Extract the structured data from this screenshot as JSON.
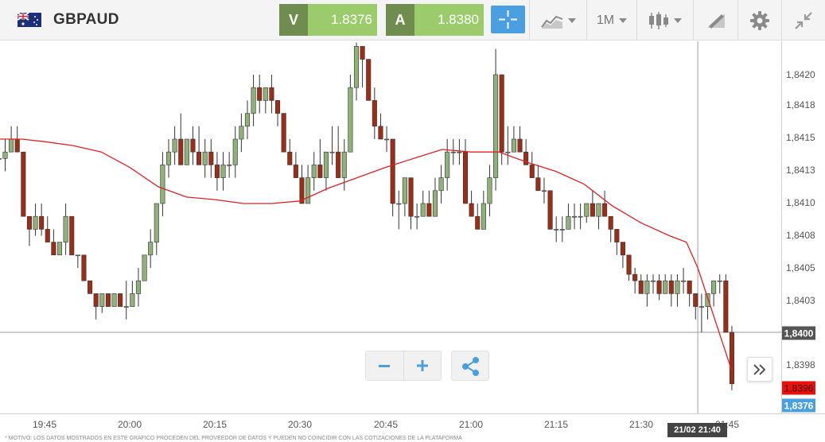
{
  "header": {
    "symbol": "GBPAUD",
    "sell": {
      "label": "V",
      "price": "1.8376"
    },
    "buy": {
      "label": "A",
      "price": "1.8380"
    },
    "crosshair_icon": "crosshair-icon",
    "indicators_icon": "indicators-icon",
    "timeframe": "1M",
    "chart_type_icon": "candlestick-icon",
    "draw_icon": "pencil-ruler-icon",
    "settings_icon": "gear-icon",
    "collapse_icon": "collapse-arrows-icon"
  },
  "chart": {
    "y_ticks": [
      "1,8420",
      "1,8418",
      "1,8415",
      "1,8413",
      "1,8410",
      "1,8408",
      "1,8405",
      "1,8403",
      "1,8398"
    ],
    "x_ticks": [
      "19:45",
      "20:00",
      "20:15",
      "20:30",
      "20:45",
      "21:00",
      "21:15",
      "21:30",
      "21:45"
    ],
    "last_price_tag": "1,8400",
    "ask_tag": "1,8396",
    "bid_tag": "1,8376",
    "crosshair_time": "21/02 21:40",
    "footer_text": "* MOTIVO: LOS DATOS MOSTRADOS EN ESTE GRÁFICO PROCEDEN DEL PROVEEDOR DE DATOS Y PUEDEN NO COINCIDIR CON LAS COTIZACIONES DE LA PLATAFORMA"
  },
  "colors": {
    "bull": "#8fb27a",
    "bear": "#9c2e17",
    "ma_line": "#e02020",
    "accent": "#4a9fe0"
  },
  "chart_data": {
    "type": "candlestick",
    "symbol": "GBPAUD",
    "interval": "1M",
    "x_range": [
      "19:37",
      "21:46"
    ],
    "ylim": [
      1.83955,
      1.84228
    ],
    "candles": [
      {
        "o": 1.84135,
        "h": 1.8415,
        "l": 1.84135,
        "c": 1.84135
      },
      {
        "o": 1.84135,
        "h": 1.8415,
        "l": 1.84125,
        "c": 1.8414
      },
      {
        "o": 1.8414,
        "h": 1.8416,
        "l": 1.8414,
        "c": 1.8415
      },
      {
        "o": 1.8415,
        "h": 1.8416,
        "l": 1.8414,
        "c": 1.8414
      },
      {
        "o": 1.8414,
        "h": 1.8414,
        "l": 1.8409,
        "c": 1.8409
      },
      {
        "o": 1.8409,
        "h": 1.8409,
        "l": 1.84067,
        "c": 1.8408
      },
      {
        "o": 1.8408,
        "h": 1.841,
        "l": 1.84075,
        "c": 1.8409
      },
      {
        "o": 1.8409,
        "h": 1.841,
        "l": 1.84075,
        "c": 1.8408
      },
      {
        "o": 1.8408,
        "h": 1.8409,
        "l": 1.8407,
        "c": 1.8407
      },
      {
        "o": 1.8407,
        "h": 1.8408,
        "l": 1.8406,
        "c": 1.8406
      },
      {
        "o": 1.8406,
        "h": 1.8406,
        "l": 1.8406,
        "c": 1.8407
      },
      {
        "o": 1.8407,
        "h": 1.841,
        "l": 1.8406,
        "c": 1.8409
      },
      {
        "o": 1.8409,
        "h": 1.8409,
        "l": 1.8406,
        "c": 1.8406
      },
      {
        "o": 1.8406,
        "h": 1.8406,
        "l": 1.8405,
        "c": 1.8406
      },
      {
        "o": 1.8406,
        "h": 1.8406,
        "l": 1.8404,
        "c": 1.8404
      },
      {
        "o": 1.8404,
        "h": 1.8404,
        "l": 1.8403,
        "c": 1.8403
      },
      {
        "o": 1.8403,
        "h": 1.8403,
        "l": 1.8401,
        "c": 1.8402
      },
      {
        "o": 1.8402,
        "h": 1.8403,
        "l": 1.84015,
        "c": 1.8403
      },
      {
        "o": 1.8403,
        "h": 1.8403,
        "l": 1.8402,
        "c": 1.8402
      },
      {
        "o": 1.8402,
        "h": 1.8403,
        "l": 1.8402,
        "c": 1.8403
      },
      {
        "o": 1.8403,
        "h": 1.8403,
        "l": 1.8402,
        "c": 1.8402
      },
      {
        "o": 1.8402,
        "h": 1.8404,
        "l": 1.8401,
        "c": 1.8402
      },
      {
        "o": 1.8402,
        "h": 1.8404,
        "l": 1.8402,
        "c": 1.8403
      },
      {
        "o": 1.8403,
        "h": 1.8405,
        "l": 1.8402,
        "c": 1.8404
      },
      {
        "o": 1.8404,
        "h": 1.8406,
        "l": 1.8404,
        "c": 1.8406
      },
      {
        "o": 1.8406,
        "h": 1.8408,
        "l": 1.8405,
        "c": 1.8407
      },
      {
        "o": 1.8407,
        "h": 1.841,
        "l": 1.8406,
        "c": 1.841
      },
      {
        "o": 1.841,
        "h": 1.8414,
        "l": 1.8409,
        "c": 1.8413
      },
      {
        "o": 1.8413,
        "h": 1.8415,
        "l": 1.8412,
        "c": 1.8414
      },
      {
        "o": 1.8414,
        "h": 1.8416,
        "l": 1.8413,
        "c": 1.8415
      },
      {
        "o": 1.8415,
        "h": 1.8417,
        "l": 1.8413,
        "c": 1.8413
      },
      {
        "o": 1.8413,
        "h": 1.8415,
        "l": 1.8413,
        "c": 1.8415
      },
      {
        "o": 1.8415,
        "h": 1.8416,
        "l": 1.8413,
        "c": 1.8414
      },
      {
        "o": 1.8414,
        "h": 1.8416,
        "l": 1.8413,
        "c": 1.8413
      },
      {
        "o": 1.8413,
        "h": 1.8415,
        "l": 1.8412,
        "c": 1.8414
      },
      {
        "o": 1.8414,
        "h": 1.8415,
        "l": 1.8412,
        "c": 1.8413
      },
      {
        "o": 1.8413,
        "h": 1.8414,
        "l": 1.8411,
        "c": 1.8412
      },
      {
        "o": 1.8412,
        "h": 1.8414,
        "l": 1.8411,
        "c": 1.8413
      },
      {
        "o": 1.8413,
        "h": 1.8414,
        "l": 1.8412,
        "c": 1.8413
      },
      {
        "o": 1.8413,
        "h": 1.8416,
        "l": 1.8412,
        "c": 1.8415
      },
      {
        "o": 1.8415,
        "h": 1.8417,
        "l": 1.8414,
        "c": 1.8416
      },
      {
        "o": 1.8416,
        "h": 1.8418,
        "l": 1.8415,
        "c": 1.8417
      },
      {
        "o": 1.8417,
        "h": 1.842,
        "l": 1.8416,
        "c": 1.8419
      },
      {
        "o": 1.8419,
        "h": 1.842,
        "l": 1.8417,
        "c": 1.8418
      },
      {
        "o": 1.8418,
        "h": 1.8419,
        "l": 1.8417,
        "c": 1.8419
      },
      {
        "o": 1.8419,
        "h": 1.842,
        "l": 1.8417,
        "c": 1.8418
      },
      {
        "o": 1.8418,
        "h": 1.8418,
        "l": 1.8416,
        "c": 1.8417
      },
      {
        "o": 1.8417,
        "h": 1.8417,
        "l": 1.8414,
        "c": 1.8414
      },
      {
        "o": 1.8414,
        "h": 1.8415,
        "l": 1.8413,
        "c": 1.8413
      },
      {
        "o": 1.8413,
        "h": 1.8414,
        "l": 1.8412,
        "c": 1.8412
      },
      {
        "o": 1.8412,
        "h": 1.8413,
        "l": 1.841,
        "c": 1.841
      },
      {
        "o": 1.841,
        "h": 1.8413,
        "l": 1.841,
        "c": 1.8412
      },
      {
        "o": 1.8412,
        "h": 1.8414,
        "l": 1.8411,
        "c": 1.8413
      },
      {
        "o": 1.8413,
        "h": 1.8415,
        "l": 1.8412,
        "c": 1.8412
      },
      {
        "o": 1.8412,
        "h": 1.8414,
        "l": 1.8411,
        "c": 1.8414
      },
      {
        "o": 1.8414,
        "h": 1.8416,
        "l": 1.8413,
        "c": 1.8414
      },
      {
        "o": 1.8414,
        "h": 1.8416,
        "l": 1.8412,
        "c": 1.8412
      },
      {
        "o": 1.8412,
        "h": 1.8415,
        "l": 1.8411,
        "c": 1.8414
      },
      {
        "o": 1.8414,
        "h": 1.842,
        "l": 1.8414,
        "c": 1.8419
      },
      {
        "o": 1.8419,
        "h": 1.84225,
        "l": 1.8418,
        "c": 1.84222
      },
      {
        "o": 1.84222,
        "h": 1.84222,
        "l": 1.8419,
        "c": 1.84212
      },
      {
        "o": 1.84212,
        "h": 1.84212,
        "l": 1.8418,
        "c": 1.8418
      },
      {
        "o": 1.8418,
        "h": 1.8419,
        "l": 1.8415,
        "c": 1.8416
      },
      {
        "o": 1.8416,
        "h": 1.8417,
        "l": 1.8415,
        "c": 1.8415
      },
      {
        "o": 1.8415,
        "h": 1.8416,
        "l": 1.8414,
        "c": 1.8415
      },
      {
        "o": 1.8415,
        "h": 1.8415,
        "l": 1.8409,
        "c": 1.841
      },
      {
        "o": 1.841,
        "h": 1.8411,
        "l": 1.8408,
        "c": 1.841
      },
      {
        "o": 1.841,
        "h": 1.8412,
        "l": 1.8409,
        "c": 1.8412
      },
      {
        "o": 1.8412,
        "h": 1.8412,
        "l": 1.8408,
        "c": 1.8409
      },
      {
        "o": 1.8409,
        "h": 1.841,
        "l": 1.8408,
        "c": 1.8409
      },
      {
        "o": 1.8409,
        "h": 1.8411,
        "l": 1.8409,
        "c": 1.841
      },
      {
        "o": 1.841,
        "h": 1.8411,
        "l": 1.8409,
        "c": 1.8409
      },
      {
        "o": 1.8409,
        "h": 1.8412,
        "l": 1.8409,
        "c": 1.8411
      },
      {
        "o": 1.8411,
        "h": 1.8413,
        "l": 1.841,
        "c": 1.8412
      },
      {
        "o": 1.8412,
        "h": 1.8415,
        "l": 1.8411,
        "c": 1.8414
      },
      {
        "o": 1.8414,
        "h": 1.8415,
        "l": 1.8413,
        "c": 1.8414
      },
      {
        "o": 1.8414,
        "h": 1.8415,
        "l": 1.8413,
        "c": 1.8414
      },
      {
        "o": 1.8414,
        "h": 1.8415,
        "l": 1.841,
        "c": 1.841
      },
      {
        "o": 1.841,
        "h": 1.8411,
        "l": 1.8409,
        "c": 1.8409
      },
      {
        "o": 1.8409,
        "h": 1.841,
        "l": 1.8408,
        "c": 1.8408
      },
      {
        "o": 1.8408,
        "h": 1.8411,
        "l": 1.8408,
        "c": 1.841
      },
      {
        "o": 1.841,
        "h": 1.8413,
        "l": 1.8409,
        "c": 1.8412
      },
      {
        "o": 1.8412,
        "h": 1.8422,
        "l": 1.8411,
        "c": 1.842
      },
      {
        "o": 1.842,
        "h": 1.842,
        "l": 1.8413,
        "c": 1.8414
      },
      {
        "o": 1.8414,
        "h": 1.8416,
        "l": 1.8413,
        "c": 1.8414
      },
      {
        "o": 1.8414,
        "h": 1.8416,
        "l": 1.8414,
        "c": 1.8415
      },
      {
        "o": 1.8415,
        "h": 1.8416,
        "l": 1.8414,
        "c": 1.8414
      },
      {
        "o": 1.8414,
        "h": 1.8415,
        "l": 1.8413,
        "c": 1.8413
      },
      {
        "o": 1.8413,
        "h": 1.8414,
        "l": 1.8412,
        "c": 1.8412
      },
      {
        "o": 1.8412,
        "h": 1.8413,
        "l": 1.8411,
        "c": 1.8411
      },
      {
        "o": 1.8411,
        "h": 1.8412,
        "l": 1.841,
        "c": 1.8411
      },
      {
        "o": 1.8411,
        "h": 1.8411,
        "l": 1.8408,
        "c": 1.8408
      },
      {
        "o": 1.8408,
        "h": 1.8409,
        "l": 1.8407,
        "c": 1.8408
      },
      {
        "o": 1.8408,
        "h": 1.8409,
        "l": 1.8407,
        "c": 1.8408
      },
      {
        "o": 1.8408,
        "h": 1.841,
        "l": 1.8408,
        "c": 1.8409
      },
      {
        "o": 1.8409,
        "h": 1.841,
        "l": 1.8408,
        "c": 1.8409
      },
      {
        "o": 1.8409,
        "h": 1.841,
        "l": 1.8408,
        "c": 1.8409
      },
      {
        "o": 1.8409,
        "h": 1.841,
        "l": 1.84085,
        "c": 1.841
      },
      {
        "o": 1.841,
        "h": 1.8411,
        "l": 1.8409,
        "c": 1.8409
      },
      {
        "o": 1.8409,
        "h": 1.841,
        "l": 1.8408,
        "c": 1.841
      },
      {
        "o": 1.841,
        "h": 1.8411,
        "l": 1.8409,
        "c": 1.8409
      },
      {
        "o": 1.8409,
        "h": 1.8409,
        "l": 1.8407,
        "c": 1.8408
      },
      {
        "o": 1.8408,
        "h": 1.8408,
        "l": 1.8406,
        "c": 1.8407
      },
      {
        "o": 1.8407,
        "h": 1.8407,
        "l": 1.8405,
        "c": 1.8406
      },
      {
        "o": 1.8406,
        "h": 1.8406,
        "l": 1.8404,
        "c": 1.84045
      },
      {
        "o": 1.84045,
        "h": 1.8405,
        "l": 1.8403,
        "c": 1.8404
      },
      {
        "o": 1.8404,
        "h": 1.84045,
        "l": 1.8403,
        "c": 1.8403
      },
      {
        "o": 1.8403,
        "h": 1.84045,
        "l": 1.8402,
        "c": 1.8404
      },
      {
        "o": 1.8404,
        "h": 1.84045,
        "l": 1.8403,
        "c": 1.8404
      },
      {
        "o": 1.8404,
        "h": 1.84045,
        "l": 1.84025,
        "c": 1.8403
      },
      {
        "o": 1.8403,
        "h": 1.84045,
        "l": 1.8403,
        "c": 1.8404
      },
      {
        "o": 1.8404,
        "h": 1.84045,
        "l": 1.8402,
        "c": 1.8403
      },
      {
        "o": 1.8403,
        "h": 1.84045,
        "l": 1.8402,
        "c": 1.8404
      },
      {
        "o": 1.8404,
        "h": 1.8405,
        "l": 1.8403,
        "c": 1.8404
      },
      {
        "o": 1.8404,
        "h": 1.8404,
        "l": 1.8402,
        "c": 1.8403
      },
      {
        "o": 1.8403,
        "h": 1.8403,
        "l": 1.8401,
        "c": 1.8402
      },
      {
        "o": 1.8402,
        "h": 1.8403,
        "l": 1.84,
        "c": 1.8402
      },
      {
        "o": 1.8402,
        "h": 1.8403,
        "l": 1.8401,
        "c": 1.8403
      },
      {
        "o": 1.8403,
        "h": 1.8404,
        "l": 1.8402,
        "c": 1.8404
      },
      {
        "o": 1.8404,
        "h": 1.84045,
        "l": 1.8403,
        "c": 1.8404
      },
      {
        "o": 1.8404,
        "h": 1.84045,
        "l": 1.84,
        "c": 1.84
      },
      {
        "o": 1.84,
        "h": 1.84005,
        "l": 1.83955,
        "c": 1.8396
      }
    ],
    "moving_average": [
      {
        "t": "19:37",
        "v": 1.8415
      },
      {
        "t": "19:41",
        "v": 1.8415
      },
      {
        "t": "19:45",
        "v": 1.84148
      },
      {
        "t": "19:50",
        "v": 1.84145
      },
      {
        "t": "19:55",
        "v": 1.8414
      },
      {
        "t": "20:00",
        "v": 1.84128
      },
      {
        "t": "20:05",
        "v": 1.84113
      },
      {
        "t": "20:10",
        "v": 1.84105
      },
      {
        "t": "20:15",
        "v": 1.84103
      },
      {
        "t": "20:20",
        "v": 1.841
      },
      {
        "t": "20:25",
        "v": 1.841
      },
      {
        "t": "20:30",
        "v": 1.84102
      },
      {
        "t": "20:35",
        "v": 1.84112
      },
      {
        "t": "20:40",
        "v": 1.8412
      },
      {
        "t": "20:45",
        "v": 1.84128
      },
      {
        "t": "20:50",
        "v": 1.84135
      },
      {
        "t": "20:55",
        "v": 1.84142
      },
      {
        "t": "21:00",
        "v": 1.8414
      },
      {
        "t": "21:05",
        "v": 1.8414
      },
      {
        "t": "21:10",
        "v": 1.84132
      },
      {
        "t": "21:15",
        "v": 1.84125
      },
      {
        "t": "21:20",
        "v": 1.84115
      },
      {
        "t": "21:25",
        "v": 1.84098
      },
      {
        "t": "21:30",
        "v": 1.84085
      },
      {
        "t": "21:35",
        "v": 1.84075
      },
      {
        "t": "21:38",
        "v": 1.8407
      },
      {
        "t": "21:40",
        "v": 1.8405
      },
      {
        "t": "21:46",
        "v": 1.8397
      }
    ]
  }
}
